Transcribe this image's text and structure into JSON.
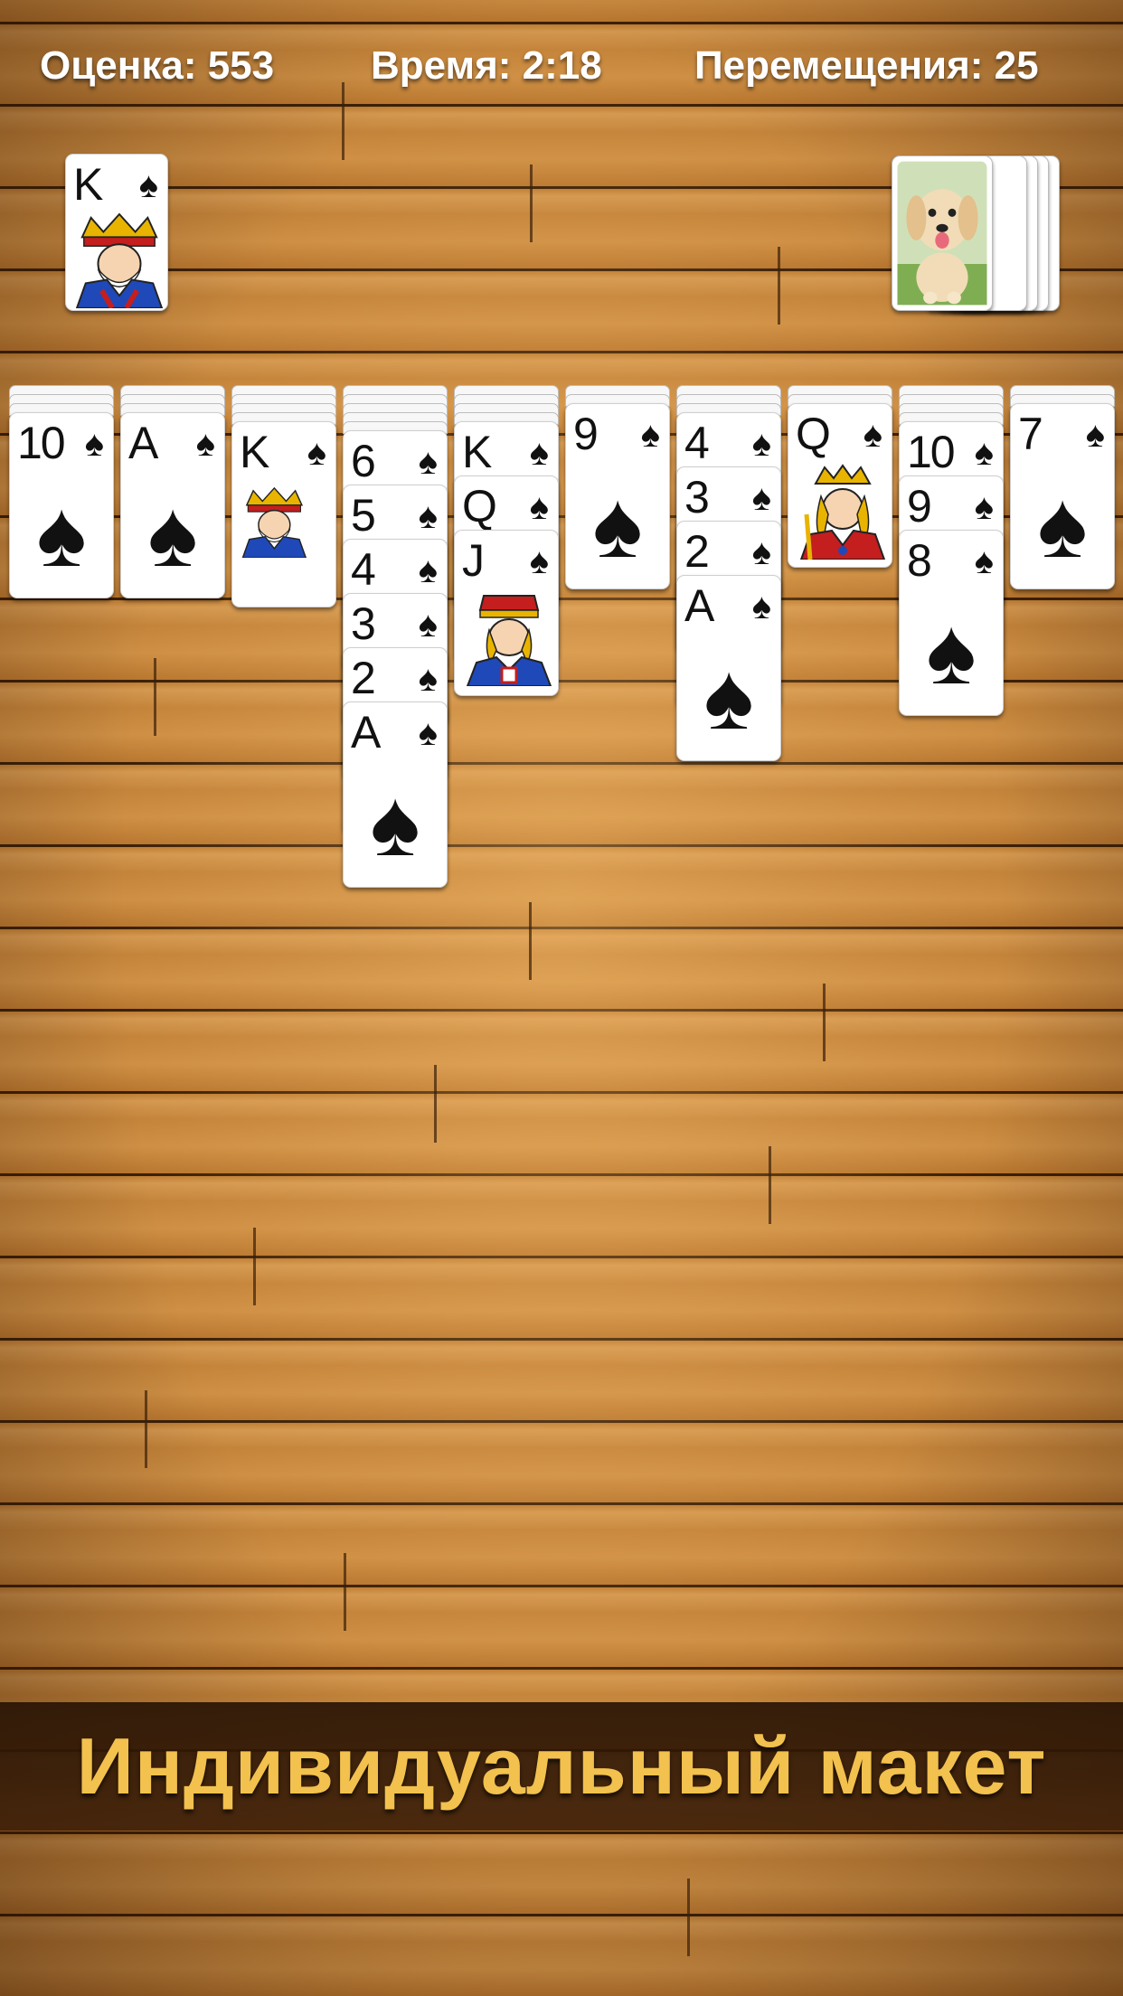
{
  "hud": {
    "score": "Оценка: 553",
    "time": "Время: 2:18",
    "moves": "Перемещения: 25"
  },
  "foundation": {
    "rank": "K",
    "suit": "♠"
  },
  "stock": {
    "image": "puppy"
  },
  "tableau": {
    "col1": {
      "top": {
        "rank": "10",
        "suit": "♠"
      }
    },
    "col2": {
      "top": {
        "rank": "A",
        "suit": "♠"
      }
    },
    "col3": {
      "top": {
        "rank": "K",
        "suit": "♠"
      }
    },
    "col4": {
      "cards": [
        {
          "rank": "6",
          "suit": "♠"
        },
        {
          "rank": "5",
          "suit": "♠"
        },
        {
          "rank": "4",
          "suit": "♠"
        },
        {
          "rank": "3",
          "suit": "♠"
        },
        {
          "rank": "2",
          "suit": "♠"
        },
        {
          "rank": "A",
          "suit": "♠"
        }
      ]
    },
    "col5": {
      "cards": [
        {
          "rank": "K",
          "suit": "♠"
        },
        {
          "rank": "Q",
          "suit": "♠"
        },
        {
          "rank": "J",
          "suit": "♠"
        }
      ]
    },
    "col6": {
      "top": {
        "rank": "9",
        "suit": "♠"
      }
    },
    "col7": {
      "cards": [
        {
          "rank": "4",
          "suit": "♠"
        },
        {
          "rank": "3",
          "suit": "♠"
        },
        {
          "rank": "2",
          "suit": "♠"
        },
        {
          "rank": "A",
          "suit": "♠"
        }
      ]
    },
    "col8": {
      "top": {
        "rank": "Q",
        "suit": "♠"
      }
    },
    "col9": {
      "cards": [
        {
          "rank": "10",
          "suit": "♠"
        },
        {
          "rank": "9",
          "suit": "♠"
        },
        {
          "rank": "8",
          "suit": "♠"
        }
      ]
    },
    "col10": {
      "top": {
        "rank": "7",
        "suit": "♠"
      }
    }
  },
  "banner": {
    "text": "Индивидуальный макет"
  },
  "colors": {
    "banner_text": "#f2c14e",
    "wood": "#c98a3c"
  }
}
